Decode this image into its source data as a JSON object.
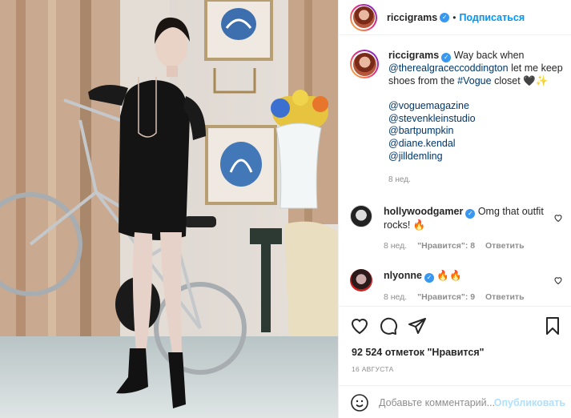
{
  "header": {
    "username": "riccigrams",
    "separator": "•",
    "follow_label": "Подписаться"
  },
  "caption": {
    "username": "riccigrams",
    "text_1": "Way back when",
    "mention_1": "@therealgraceccoddington",
    "text_2": "let me keep shoes from the",
    "hashtag": "#Vogue",
    "text_3": "closet 🖤✨",
    "tags": [
      "@voguemagazine",
      "@stevenkleinstudio",
      "@bartpumpkin",
      "@diane.kendal",
      "@jilldemling"
    ],
    "time": "8 нед."
  },
  "comments": [
    {
      "username": "hollywoodgamer",
      "text": "Omg that outfit rocks! 🔥",
      "time": "8 нед.",
      "reply_label": "Ответить"
    },
    {
      "username": "nlyonne",
      "text": "🔥🔥",
      "time": "8 нед.",
      "likes_label": "\"Нравится\": 9",
      "reply_label": "Ответить"
    }
  ],
  "comment_likes_1": "\"Нравится\": 8",
  "likes": "92 524 отметок \"Нравится\"",
  "date": "16 АВГУСТА",
  "add_comment": {
    "placeholder": "Добавьте комментарий...",
    "publish_label": "Опубликовать"
  },
  "icons": {
    "verified": "verified-badge-icon",
    "like": "heart-icon",
    "comment": "comment-icon",
    "share": "paper-plane-icon",
    "save": "bookmark-icon",
    "emoji": "smiley-icon"
  },
  "colors": {
    "accent": "#0095f6",
    "verified": "#3897f0",
    "muted": "#8e8e8e",
    "link": "#00376b"
  }
}
